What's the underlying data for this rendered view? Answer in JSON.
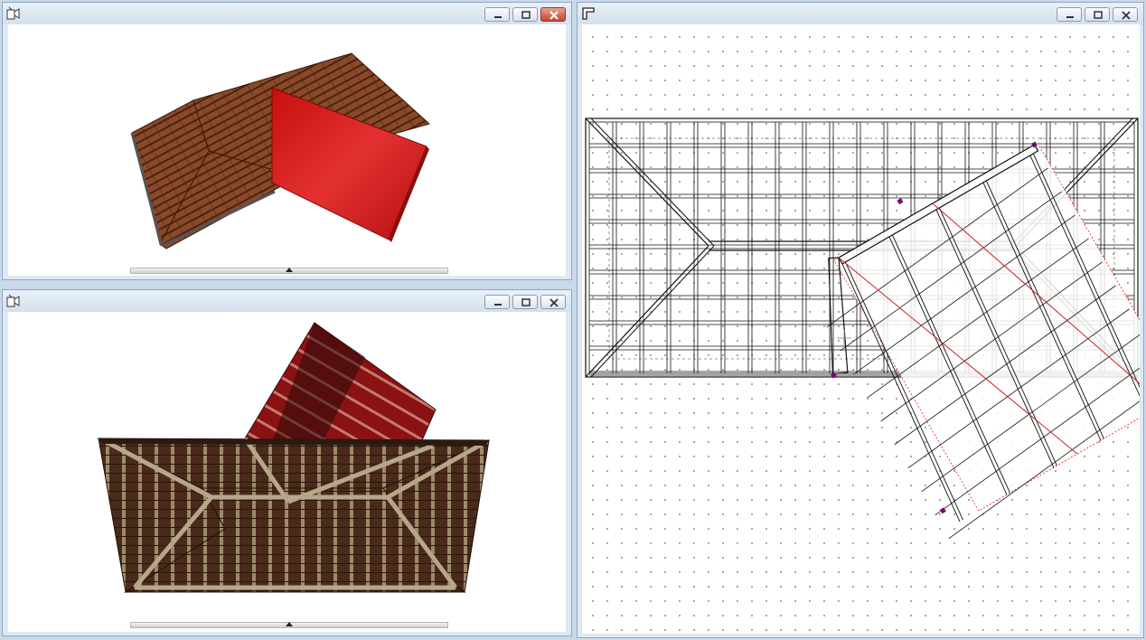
{
  "windows": {
    "top_left": {
      "title": "",
      "view": "3d-roof-render"
    },
    "bottom_left": {
      "title": "",
      "view": "3d-roof-framing"
    },
    "right": {
      "title": "",
      "view": "plan-view"
    }
  },
  "window_buttons": {
    "minimize": "minimize-icon",
    "maximize": "restore-icon",
    "close": "close-icon"
  },
  "colors": {
    "roof_tile": "#8b4a2b",
    "selected_plane": "#d11b1b",
    "selection_outline": "#e02020",
    "handle": "#7a007a"
  }
}
